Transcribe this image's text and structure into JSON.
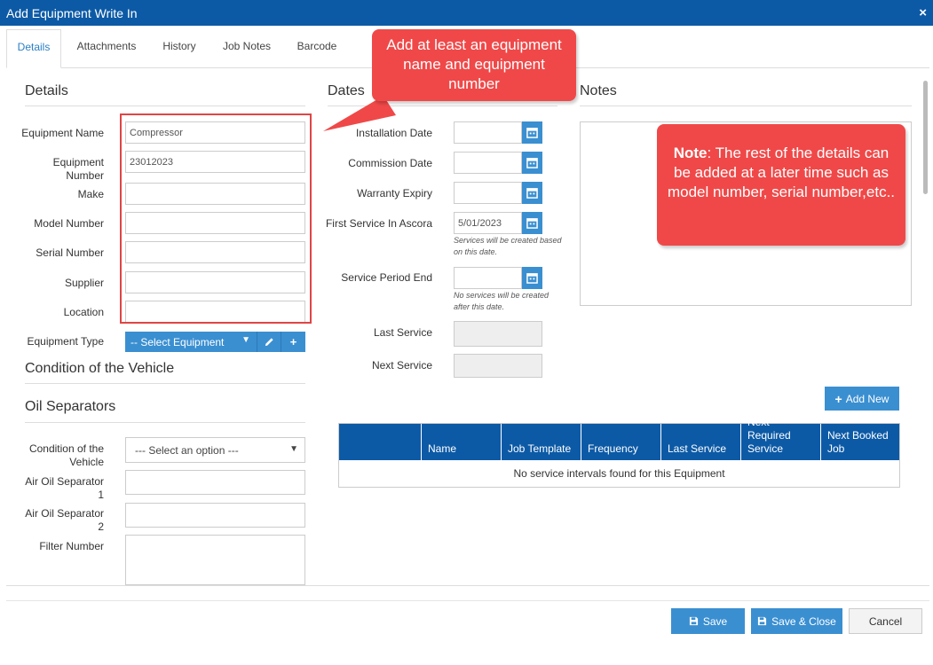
{
  "window": {
    "title": "Add Equipment Write In",
    "close_glyph": "×"
  },
  "tabs": [
    {
      "label": "Details",
      "active": true
    },
    {
      "label": "Attachments"
    },
    {
      "label": "History"
    },
    {
      "label": "Job Notes"
    },
    {
      "label": "Barcode"
    }
  ],
  "details": {
    "title": "Details",
    "fields": {
      "equipment_name": {
        "label": "Equipment Name",
        "value": "Compressor"
      },
      "equipment_number": {
        "label_1": "Equipment",
        "label_2": "Number",
        "value": "23012023"
      },
      "make": {
        "label": "Make",
        "value": ""
      },
      "model_number": {
        "label": "Model Number",
        "value": ""
      },
      "serial_number": {
        "label": "Serial Number",
        "value": ""
      },
      "supplier": {
        "label": "Supplier",
        "value": ""
      },
      "location": {
        "label": "Location",
        "value": ""
      }
    },
    "equipment_type": {
      "label": "Equipment Type",
      "value": "-- Select Equipment"
    }
  },
  "condition": {
    "title": "Condition of the Vehicle"
  },
  "oil": {
    "title": "Oil Separators",
    "condition_label_1": "Condition of the",
    "condition_label_2": "Vehicle",
    "condition_value": "--- Select an option ---",
    "aos1_label_1": "Air Oil Separator",
    "aos1_label_2": "1",
    "aos2_label_1": "Air Oil Separator",
    "aos2_label_2": "2",
    "filter_label": "Filter Number"
  },
  "dates": {
    "title": "Dates",
    "installation": {
      "label": "Installation Date",
      "value": ""
    },
    "commission": {
      "label": "Commission Date",
      "value": ""
    },
    "warranty": {
      "label": "Warranty Expiry",
      "value": ""
    },
    "first_service": {
      "label": "First Service In Ascora",
      "value": "5/01/2023",
      "hint_1": "Services will be created based",
      "hint_2": "on this date."
    },
    "period_end": {
      "label": "Service Period End",
      "value": "",
      "hint_1": "No services will be created",
      "hint_2": "after this date."
    },
    "last_service": {
      "label": "Last Service"
    },
    "next_service": {
      "label": "Next Service"
    }
  },
  "notes": {
    "title": "Notes"
  },
  "callouts": {
    "top": "Add at least an equipment name and equipment number",
    "note_bold": "Note",
    "note_rest": ": The rest of the details can be added at a later time such as model number, serial number,etc.."
  },
  "intervals": {
    "add_new": "Add New",
    "columns": [
      "",
      "Name",
      "Job Template",
      "Frequency",
      "Last Service",
      "Next Required Service",
      "Next Booked Job"
    ],
    "empty": "No service intervals found for this Equipment"
  },
  "footer": {
    "save": "Save",
    "save_close": "Save & Close",
    "cancel": "Cancel"
  },
  "colors": {
    "header_blue": "#0c5aa6",
    "button_blue": "#3a8fd1",
    "callout_red": "#f04848"
  }
}
